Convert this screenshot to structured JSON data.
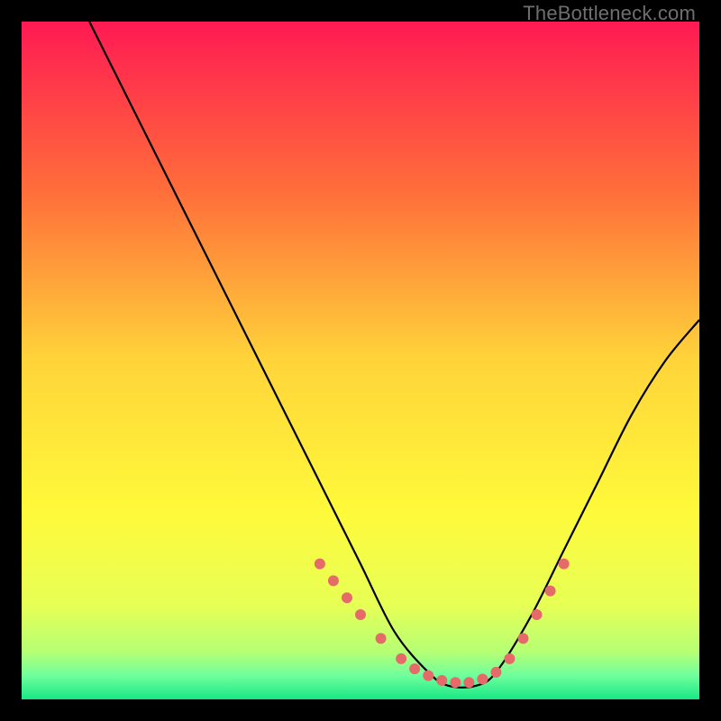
{
  "watermark": "TheBottleneck.com",
  "chart_data": {
    "type": "line",
    "title": "",
    "xlabel": "",
    "ylabel": "",
    "xlim": [
      0,
      100
    ],
    "ylim": [
      0,
      100
    ],
    "grid": false,
    "legend": false,
    "background_gradient_stops": [
      {
        "offset": 0.0,
        "color": "#ff1a53"
      },
      {
        "offset": 0.25,
        "color": "#ff6e3a"
      },
      {
        "offset": 0.5,
        "color": "#ffd43a"
      },
      {
        "offset": 0.72,
        "color": "#fff93a"
      },
      {
        "offset": 0.86,
        "color": "#e7ff55"
      },
      {
        "offset": 0.93,
        "color": "#b6ff74"
      },
      {
        "offset": 0.965,
        "color": "#6fff9d"
      },
      {
        "offset": 1.0,
        "color": "#17e884"
      }
    ],
    "curve": {
      "x": [
        10,
        15,
        20,
        25,
        30,
        35,
        40,
        45,
        50,
        55,
        60,
        63,
        67,
        70,
        75,
        80,
        85,
        90,
        95,
        100
      ],
      "y": [
        100,
        90,
        80,
        70,
        60,
        50,
        40,
        30,
        20,
        10,
        4,
        2,
        2,
        4,
        12,
        22,
        32,
        42,
        50,
        56
      ]
    },
    "marker_band": {
      "y_threshold": 20,
      "color": "#e76a6a",
      "radius": 6,
      "points_x": [
        44,
        46,
        48,
        50,
        53,
        56,
        58,
        60,
        62,
        64,
        66,
        68,
        70,
        72,
        74,
        76,
        78,
        80
      ],
      "points_y": [
        20,
        17.5,
        15,
        12.5,
        9,
        6,
        4.5,
        3.5,
        2.8,
        2.5,
        2.5,
        3,
        4,
        6,
        9,
        12.5,
        16,
        20
      ]
    }
  }
}
